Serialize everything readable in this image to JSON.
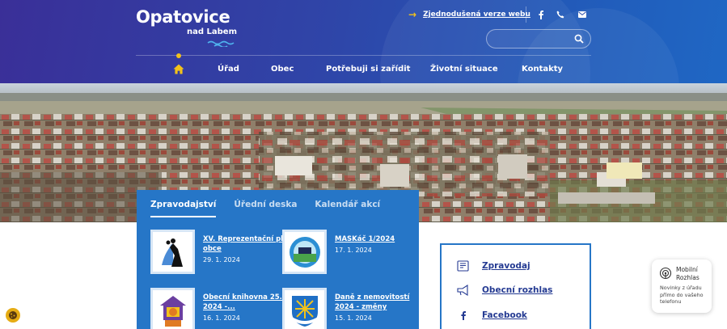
{
  "header": {
    "logo_title": "Opatovice",
    "logo_subtitle": "nad Labem",
    "easy_version_label": "Zjednodušená verze webu",
    "social": [
      "facebook-icon",
      "phone-icon",
      "mail-icon"
    ],
    "search": {
      "placeholder": ""
    }
  },
  "nav": {
    "home_icon": "home-icon",
    "items": [
      "Úřad",
      "Obec",
      "Potřebuji si zařídit",
      "Životní situace",
      "Kontakty"
    ]
  },
  "news": {
    "tabs": [
      "Zpravodajství",
      "Úřední deska",
      "Kalendář akcí"
    ],
    "active_tab": 0,
    "items": [
      {
        "title": "XV. Reprezentační ples obce",
        "date": "29. 1. 2024"
      },
      {
        "title": "MASKáč 1/2024",
        "date": "17. 1. 2024"
      },
      {
        "title": "Obecní knihovna 25. 1. 2024 -...",
        "date": "16. 1. 2024"
      },
      {
        "title": "Daně z nemovitostí 2024 - změny",
        "date": "15. 1. 2024"
      }
    ]
  },
  "links": [
    {
      "label": "Zpravodaj",
      "icon": "newspaper-icon"
    },
    {
      "label": "Obecní rozhlas",
      "icon": "megaphone-icon"
    },
    {
      "label": "Facebook",
      "icon": "facebook-icon"
    }
  ],
  "mobile_rozhlas": {
    "title_line1": "Mobilní",
    "title_line2": "Rozhlas",
    "description": "Novinky z úřadu přímo do vašeho telefonu"
  },
  "colors": {
    "header": "#2f45a8",
    "accent": "#f2c21b",
    "panel": "#2676c7",
    "link": "#243a92"
  }
}
